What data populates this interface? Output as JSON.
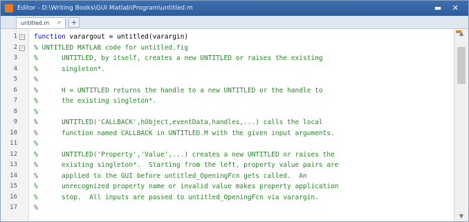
{
  "window": {
    "title": "Editor - D:\\Writing Books\\GUI Matlab\\Program\\untitled.m",
    "buttons": "▬ ✕"
  },
  "tabs": [
    {
      "label": "untitled.m",
      "close": "×"
    }
  ],
  "tab_add": "+",
  "editor": {
    "lines": [
      {
        "n": "1",
        "fold": "−",
        "kw": "function ",
        "text": "varargout = untitled(varargin)",
        "cls": "plain"
      },
      {
        "n": "2",
        "fold": "−",
        "kw": "",
        "text": "% UNTITLED MATLAB code for untitled.fig",
        "cls": "cm"
      },
      {
        "n": "3",
        "fold": "",
        "kw": "",
        "text": "%      UNTITLED, by itself, creates a new UNTITLED or raises the existing",
        "cls": "cm"
      },
      {
        "n": "4",
        "fold": "",
        "kw": "",
        "text": "%      singleton*.",
        "cls": "cm"
      },
      {
        "n": "5",
        "fold": "",
        "kw": "",
        "text": "%",
        "cls": "cm"
      },
      {
        "n": "6",
        "fold": "",
        "kw": "",
        "text": "%      H = UNTITLED returns the handle to a new UNTITLED or the handle to",
        "cls": "cm"
      },
      {
        "n": "7",
        "fold": "",
        "kw": "",
        "text": "%      the existing singleton*.",
        "cls": "cm"
      },
      {
        "n": "8",
        "fold": "",
        "kw": "",
        "text": "%",
        "cls": "cm"
      },
      {
        "n": "9",
        "fold": "",
        "kw": "",
        "text": "%      UNTITLED('CALLBACK',hObject,eventData,handles,...) calls the local",
        "cls": "cm"
      },
      {
        "n": "10",
        "fold": "",
        "kw": "",
        "text": "%      function named CALLBACK in UNTITLED.M with the given input arguments.",
        "cls": "cm"
      },
      {
        "n": "11",
        "fold": "",
        "kw": "",
        "text": "%",
        "cls": "cm"
      },
      {
        "n": "12",
        "fold": "",
        "kw": "",
        "text": "%      UNTITLED('Property','Value',...) creates a new UNTITLED or raises the",
        "cls": "cm"
      },
      {
        "n": "13",
        "fold": "",
        "kw": "",
        "text": "%      existing singleton*.  Starting from the left, property value pairs are",
        "cls": "cm"
      },
      {
        "n": "14",
        "fold": "",
        "kw": "",
        "text": "%      applied to the GUI before untitled_OpeningFcn gets called.  An",
        "cls": "cm"
      },
      {
        "n": "15",
        "fold": "",
        "kw": "",
        "text": "%      unrecognized property name or invalid value makes property application",
        "cls": "cm"
      },
      {
        "n": "16",
        "fold": "",
        "kw": "",
        "text": "%      stop.  All inputs are passed to untitled_OpeningFcn via varargin.",
        "cls": "cm"
      },
      {
        "n": "17",
        "fold": "",
        "kw": "",
        "text": "%",
        "cls": "cm"
      }
    ]
  },
  "scrollbar": {
    "up": "▲",
    "down": "▼"
  }
}
